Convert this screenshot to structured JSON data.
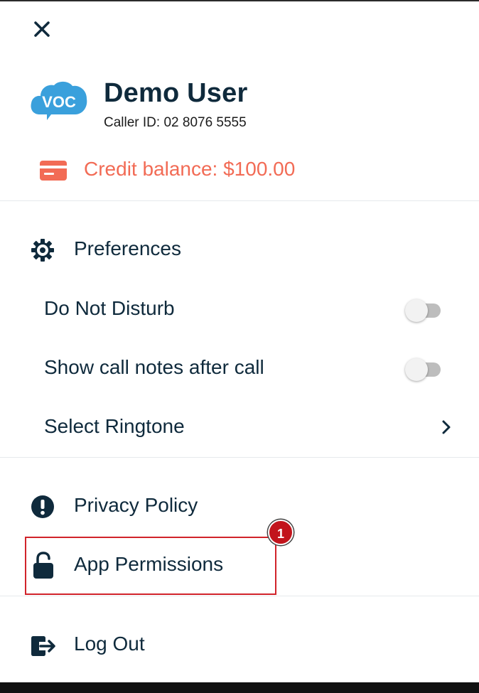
{
  "menu": {
    "close_icon": "close-icon",
    "logo_text": "VOC"
  },
  "profile": {
    "name": "Demo User",
    "caller_id": "Caller ID: 02 8076 5555"
  },
  "credit": {
    "label": "Credit balance: $100.00",
    "icon": "credit-card-icon",
    "color": "#f26b55"
  },
  "preferences": {
    "title": "Preferences",
    "icon": "gear-icon",
    "items": [
      {
        "label": "Do Not Disturb",
        "type": "toggle",
        "on": false
      },
      {
        "label": "Show call notes after call",
        "type": "toggle",
        "on": false
      },
      {
        "label": "Select Ringtone",
        "type": "link"
      }
    ]
  },
  "links": {
    "privacy": {
      "label": "Privacy Policy",
      "icon": "info-exclamation-icon"
    },
    "permissions": {
      "label": "App Permissions",
      "icon": "unlock-icon"
    },
    "logout": {
      "label": "Log Out",
      "icon": "logout-icon"
    }
  },
  "annotation": {
    "badge": "1",
    "color": "#d1232a"
  },
  "colors": {
    "text": "#0f2a3c",
    "logo": "#3aa0dc"
  }
}
